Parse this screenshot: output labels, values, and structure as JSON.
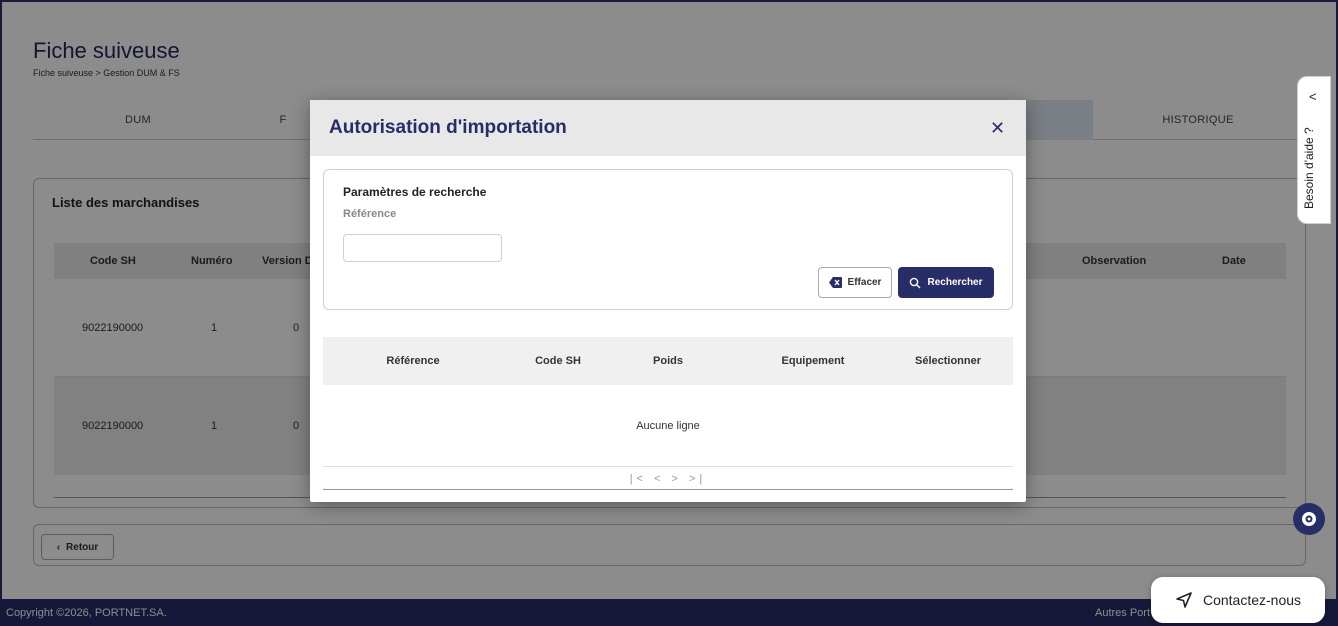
{
  "page": {
    "title": "Fiche suiveuse",
    "breadcrumb": "Fiche suiveuse > Gestion DUM & FS"
  },
  "tabs": [
    "DUM",
    "F",
    "HISTORIQUE"
  ],
  "goods": {
    "title": "Liste des marchandises",
    "columns": [
      "Code SH",
      "Numéro",
      "Version D",
      "Observation",
      "Date"
    ],
    "rows": [
      {
        "code_sh": "9022190000",
        "numero": "1",
        "version": "0"
      },
      {
        "code_sh": "9022190000",
        "numero": "1",
        "version": "0"
      }
    ]
  },
  "actions": {
    "back_label": "Retour"
  },
  "help": {
    "label": "Besoin d'aide ?"
  },
  "contact": {
    "label": "Contactez-nous"
  },
  "footer": {
    "copyright": "Copyright ©2026, PORTNET.SA.",
    "other": "Autres Port"
  },
  "modal": {
    "title": "Autorisation d'importation",
    "close": "✕",
    "search": {
      "title": "Paramètres de recherche",
      "reference_label": "Référence",
      "reference_value": "",
      "clear_label": "Effacer",
      "search_label": "Rechercher"
    },
    "results": {
      "columns": [
        "Référence",
        "Code SH",
        "Poids",
        "Equipement",
        "Sélectionner"
      ],
      "empty": "Aucune ligne",
      "pager": "|<  <  >  >|"
    }
  },
  "colors": {
    "brand": "#272d67",
    "overlay": "rgba(0,0,0,0.45)"
  }
}
